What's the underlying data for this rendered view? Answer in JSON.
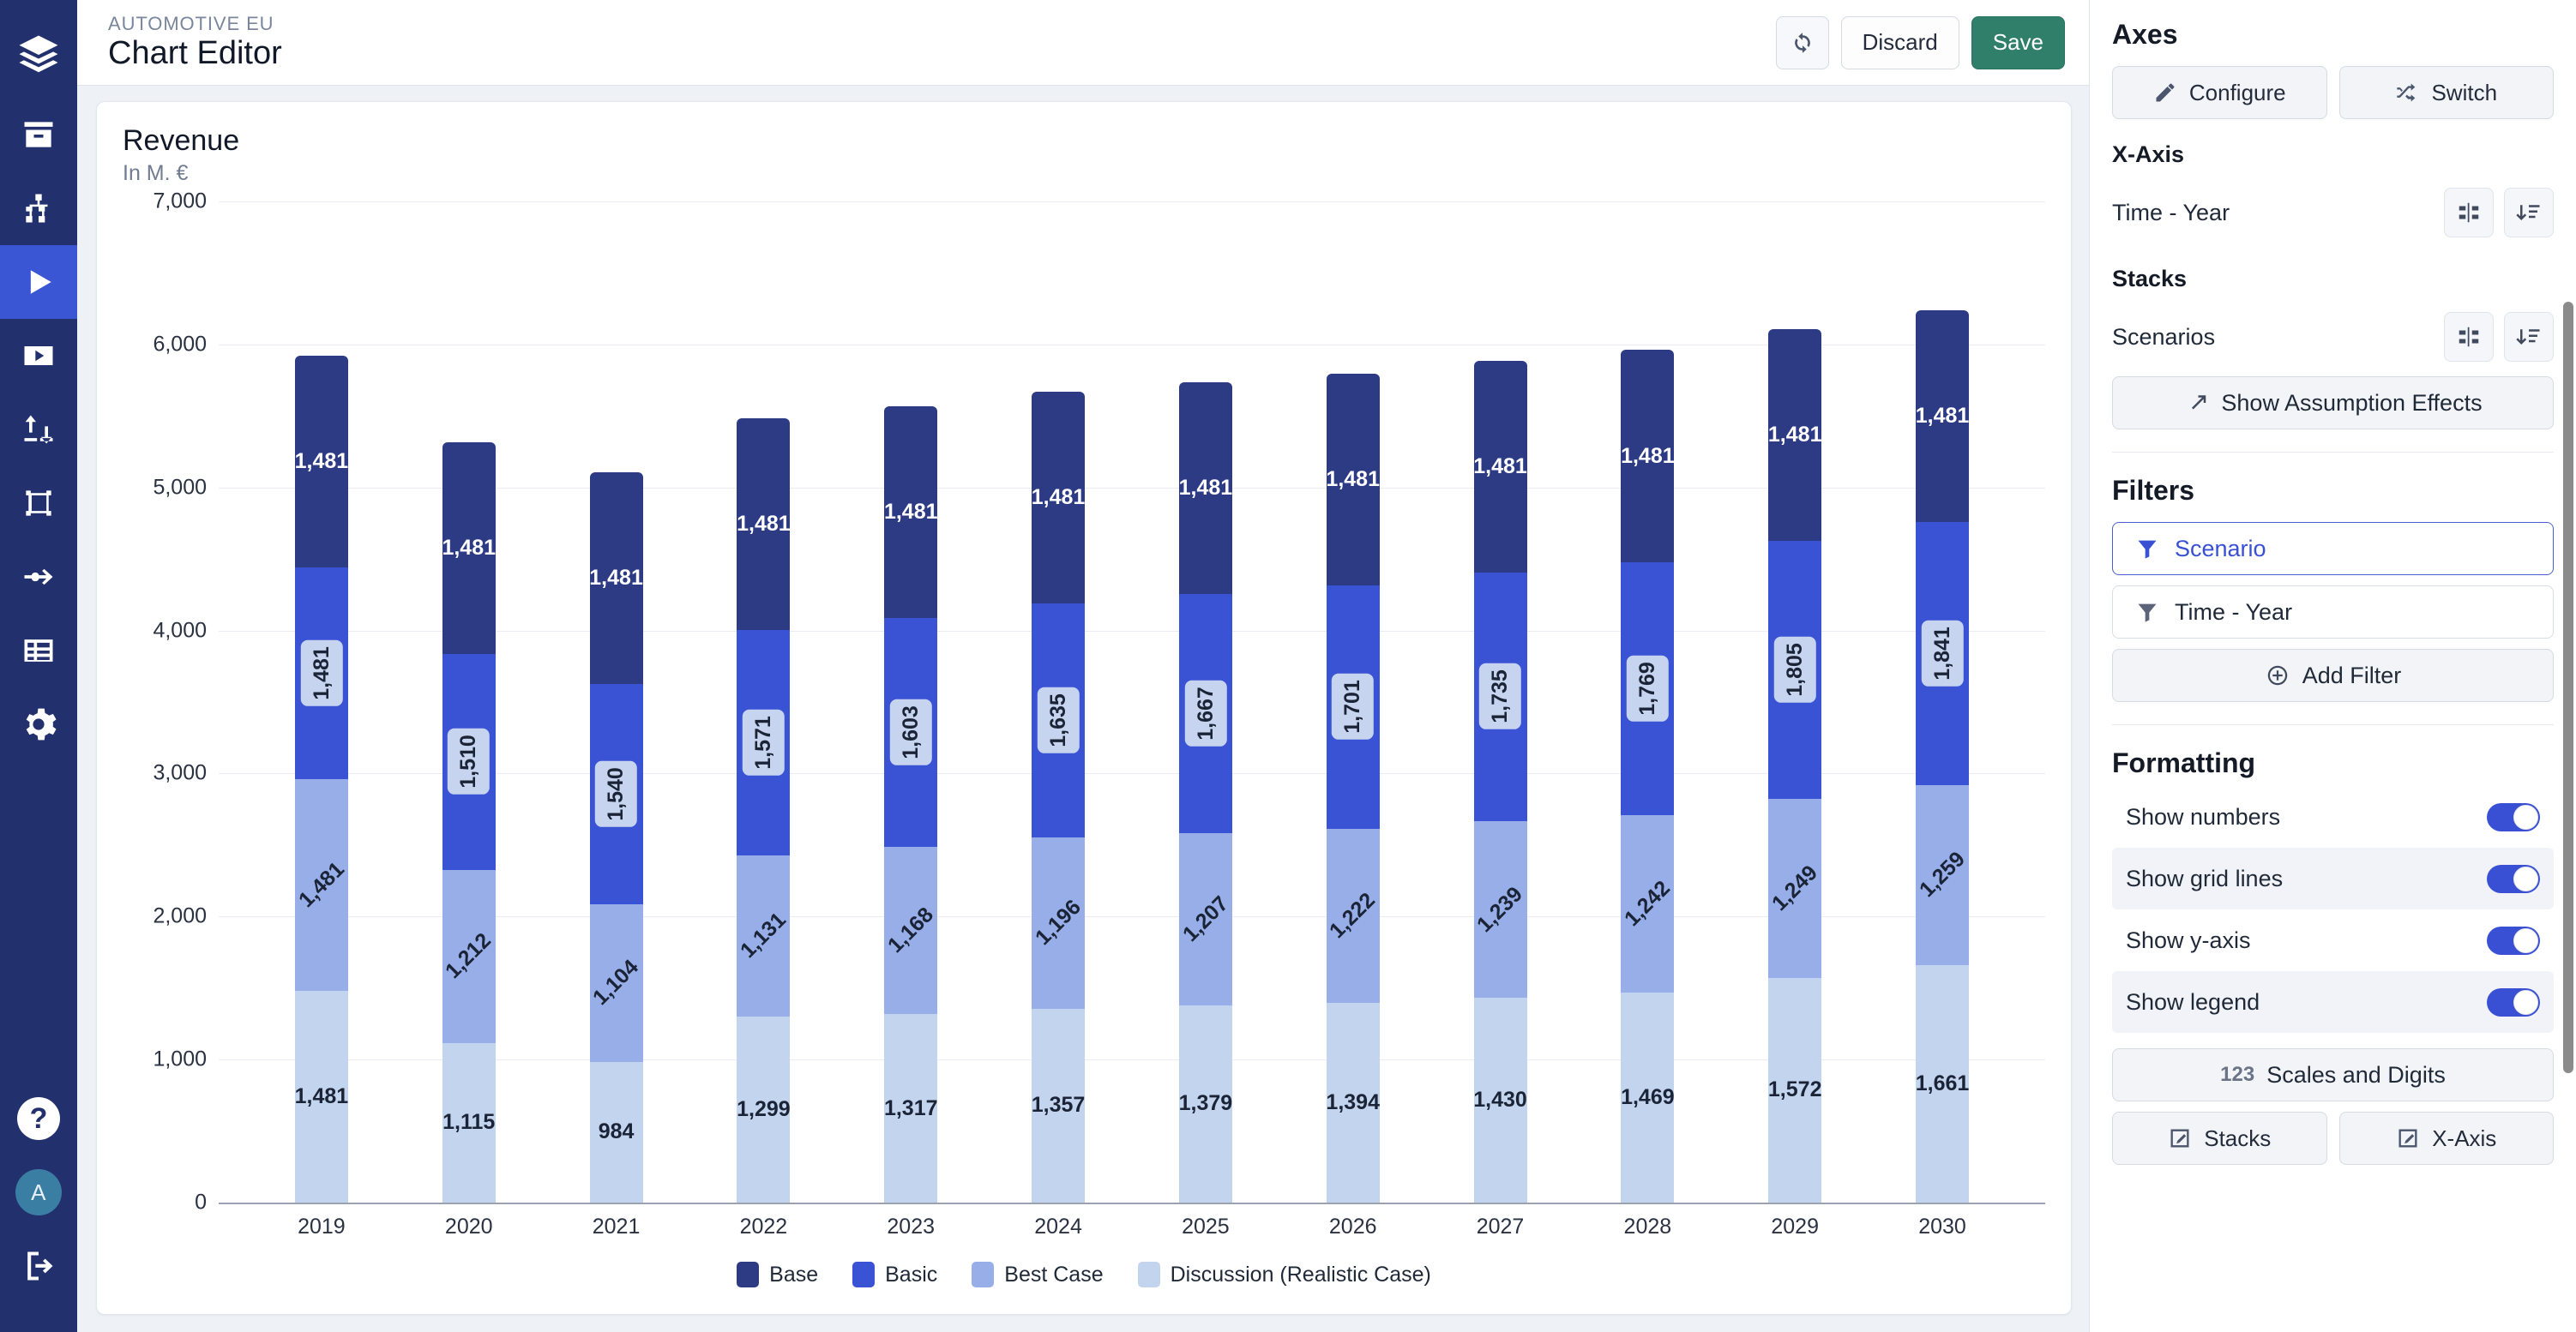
{
  "rail": {
    "logo_icon": "layers-logo-icon",
    "items": [
      {
        "name": "archive-icon"
      },
      {
        "name": "org-chart-icon"
      },
      {
        "name": "play-icon",
        "active": true
      },
      {
        "name": "video-icon"
      },
      {
        "name": "transfer-icon"
      },
      {
        "name": "bounding-box-icon"
      },
      {
        "name": "arrow-flow-icon"
      },
      {
        "name": "table-icon"
      },
      {
        "name": "gear-icon"
      }
    ],
    "help_label": "?",
    "avatar_initial": "A",
    "logout_icon": "logout-icon"
  },
  "topbar": {
    "breadcrumb": "AUTOMOTIVE EU",
    "title": "Chart Editor",
    "refresh_label": "refresh",
    "discard_label": "Discard",
    "save_label": "Save"
  },
  "card": {
    "title": "Revenue",
    "subtitle": "In M. €"
  },
  "panel": {
    "axes_heading": "Axes",
    "configure_label": "Configure",
    "switch_label": "Switch",
    "xaxis_heading": "X-Axis",
    "xaxis_value": "Time - Year",
    "stacks_heading": "Stacks",
    "stacks_value": "Scenarios",
    "assumption_label": "Show Assumption Effects",
    "filters_heading": "Filters",
    "filters": [
      {
        "label": "Scenario",
        "selected": true
      },
      {
        "label": "Time - Year",
        "selected": false
      }
    ],
    "add_filter_label": "Add Filter",
    "formatting_heading": "Formatting",
    "toggles": [
      {
        "label": "Show numbers",
        "on": true
      },
      {
        "label": "Show grid lines",
        "on": true
      },
      {
        "label": "Show y-axis",
        "on": true
      },
      {
        "label": "Show legend",
        "on": true
      }
    ],
    "scales_label": "Scales and Digits",
    "scales_prefix": "123",
    "stacks_btn_label": "Stacks",
    "xaxis_btn_label": "X-Axis"
  },
  "chart_data": {
    "type": "bar",
    "stacked": true,
    "title": "Revenue",
    "subtitle": "In M. €",
    "xlabel": "",
    "ylabel": "",
    "ylim": [
      0,
      7000
    ],
    "yticks": [
      0,
      1000,
      2000,
      3000,
      4000,
      5000,
      6000,
      7000
    ],
    "ytick_labels": [
      "0",
      "1,000",
      "2,000",
      "3,000",
      "4,000",
      "5,000",
      "6,000",
      "7,000"
    ],
    "grid": true,
    "legend_position": "bottom",
    "categories": [
      "2019",
      "2020",
      "2021",
      "2022",
      "2023",
      "2024",
      "2025",
      "2026",
      "2027",
      "2028",
      "2029",
      "2030"
    ],
    "series": [
      {
        "name": "Discussion (Realistic Case)",
        "color": "#c3d4ef",
        "label_style": "horizontal",
        "values": [
          1481,
          1115,
          984,
          1299,
          1317,
          1357,
          1379,
          1394,
          1430,
          1469,
          1572,
          1661
        ],
        "labels": [
          "1,481",
          "1,115",
          "984",
          "1,299",
          "1,317",
          "1,357",
          "1,379",
          "1,394",
          "1,430",
          "1,469",
          "1,572",
          "1,661"
        ]
      },
      {
        "name": "Best Case",
        "color": "#97aee8",
        "label_style": "rot45",
        "values": [
          1481,
          1212,
          1104,
          1131,
          1168,
          1196,
          1207,
          1222,
          1239,
          1242,
          1249,
          1259
        ],
        "labels": [
          "1,481",
          "1,212",
          "1,104",
          "1,131",
          "1,168",
          "1,196",
          "1,207",
          "1,222",
          "1,239",
          "1,242",
          "1,249",
          "1,259"
        ]
      },
      {
        "name": "Basic",
        "color": "#3a53d4",
        "label_style": "rot90-badge",
        "values": [
          1481,
          1510,
          1540,
          1571,
          1603,
          1635,
          1667,
          1701,
          1735,
          1769,
          1805,
          1841
        ],
        "labels": [
          "1,481",
          "1,510",
          "1,540",
          "1,571",
          "1,603",
          "1,635",
          "1,667",
          "1,701",
          "1,735",
          "1,769",
          "1,805",
          "1,841"
        ]
      },
      {
        "name": "Base",
        "color": "#2d3b85",
        "label_style": "horizontal-white",
        "values": [
          1481,
          1481,
          1481,
          1481,
          1481,
          1481,
          1481,
          1481,
          1481,
          1481,
          1481,
          1481
        ],
        "labels": [
          "1,481",
          "1,481",
          "1,481",
          "1,481",
          "1,481",
          "1,481",
          "1,481",
          "1,481",
          "1,481",
          "1,481",
          "1,481",
          "1,481"
        ]
      }
    ],
    "legend": [
      {
        "label": "Base",
        "color": "#2d3b85"
      },
      {
        "label": "Basic",
        "color": "#3a53d4"
      },
      {
        "label": "Best Case",
        "color": "#97aee8"
      },
      {
        "label": "Discussion (Realistic Case)",
        "color": "#c3d4ef"
      }
    ]
  }
}
